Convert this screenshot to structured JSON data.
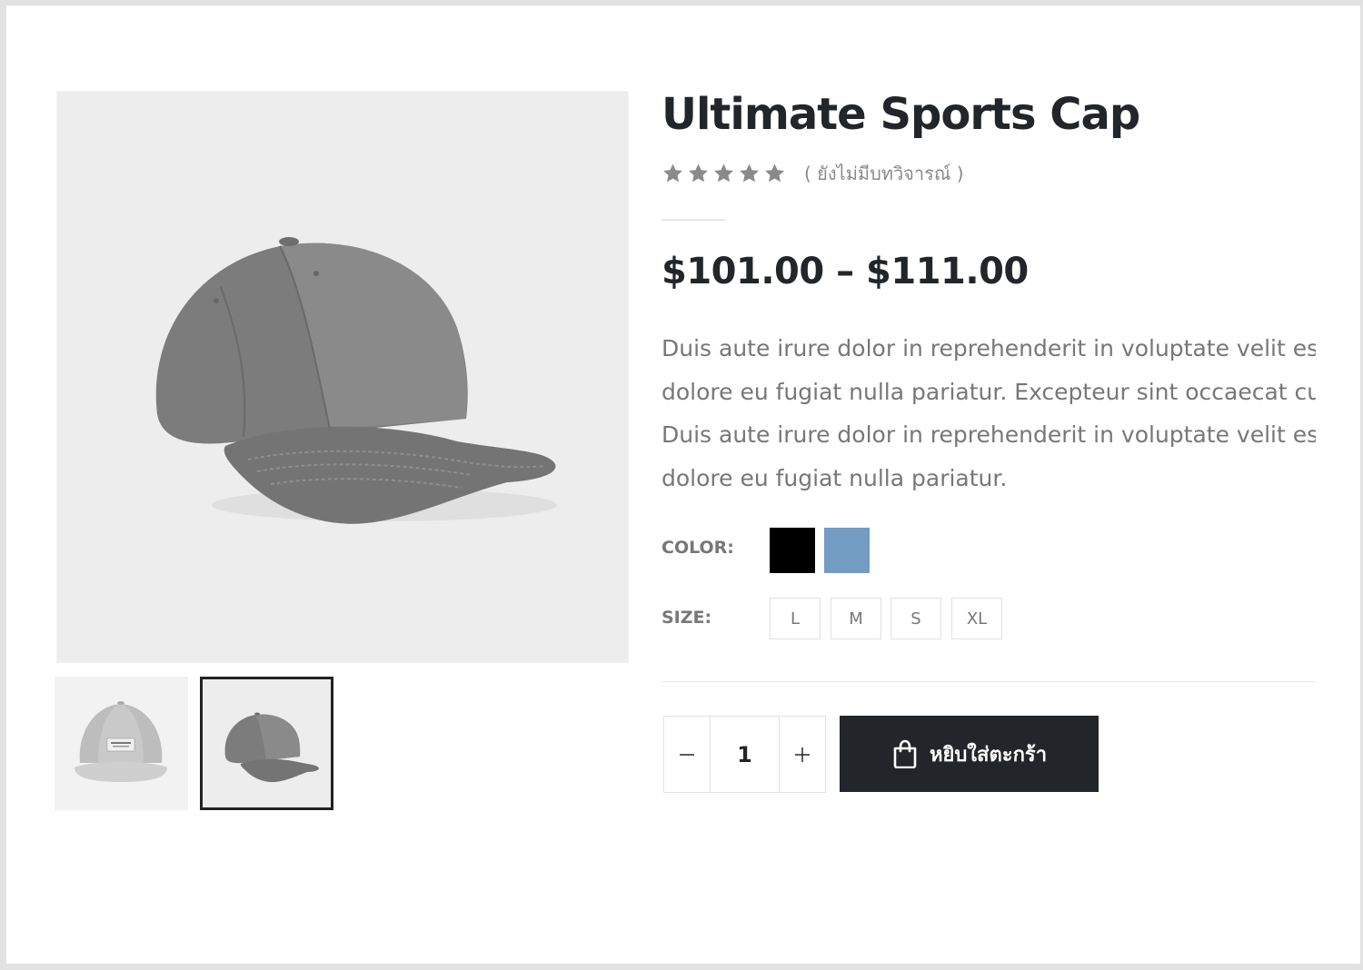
{
  "product": {
    "title": "Ultimate Sports Cap",
    "rating": {
      "stars": 5,
      "filled": 0,
      "review_text": "( ยังไม่มีบทวิจารณ์ )"
    },
    "price_range": "$101.00 – $111.00",
    "description_lines": [
      "Duis aute irure dolor in reprehenderit in voluptate velit esse cillum",
      "dolore eu fugiat nulla pariatur. Excepteur sint occaecat cupidatat non",
      "Duis aute irure dolor in reprehenderit in voluptate velit esse cillum",
      "dolore eu fugiat nulla pariatur."
    ],
    "color_label": "COLOR:",
    "colors": [
      {
        "name": "black",
        "hex": "#000000"
      },
      {
        "name": "blue",
        "hex": "#729cc2"
      }
    ],
    "size_label": "SIZE:",
    "sizes": [
      "L",
      "M",
      "S",
      "XL"
    ],
    "quantity": "1",
    "add_to_cart_label": "หยิบใส่ตะกร้า"
  },
  "gallery": {
    "main_image": "grey-baseball-cap",
    "thumbnails": [
      {
        "image": "light-grey-snapback-cap",
        "selected": false
      },
      {
        "image": "grey-baseball-cap",
        "selected": true
      }
    ]
  },
  "theme": {
    "dark": "#222529",
    "muted_text": "#777777",
    "star_color": "#8a8a8a",
    "image_bg": "#ededed"
  }
}
